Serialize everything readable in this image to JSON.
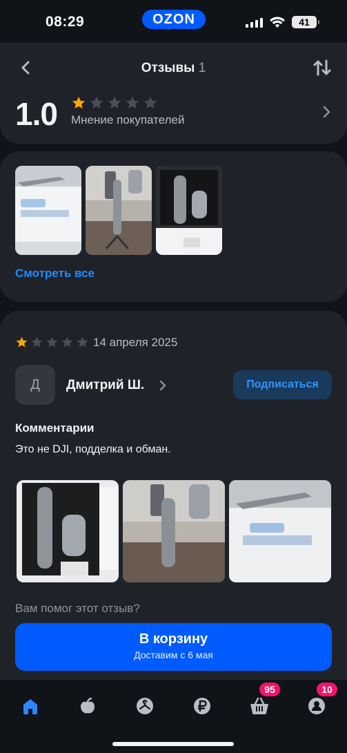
{
  "status_bar": {
    "time": "08:29",
    "brand": "OZON",
    "battery": "41"
  },
  "header": {
    "title": "Отзывы",
    "count": "1",
    "rating": "1.0",
    "rating_stars_filled": 1,
    "rating_stars_total": 5,
    "rating_caption": "Мнение покупателей"
  },
  "photos": {
    "see_all": "Смотреть все",
    "items": [
      "photo-box-3-axis-gimbal",
      "photo-gimbal-on-chair",
      "photo-gimbal-in-box"
    ]
  },
  "review": {
    "stars_filled": 1,
    "stars_total": 5,
    "date": "14 апреля 2025",
    "avatar_letter": "Д",
    "author": "Дмитрий Ш.",
    "subscribe_label": "Подписаться",
    "comment_label": "Комментарии",
    "comment_text": "Это не DJI, подделка и обман.",
    "helpful_question": "Вам помог этот отзыв?"
  },
  "cart_button": {
    "title": "В корзину",
    "subtitle": "Доставим с 6 мая"
  },
  "tab_bar": {
    "items": [
      {
        "icon": "home-icon",
        "active": true
      },
      {
        "icon": "fresh-icon",
        "active": false
      },
      {
        "icon": "catalog-icon",
        "active": false
      },
      {
        "icon": "finance-icon",
        "active": false
      },
      {
        "icon": "cart-icon",
        "active": false,
        "badge": "95"
      },
      {
        "icon": "profile-icon",
        "active": false,
        "badge": "10"
      }
    ]
  },
  "colors": {
    "accent": "#005bff",
    "link": "#1e8cff",
    "star_filled": "#ffa800",
    "star_empty": "#4a4f57",
    "badge": "#f3136c",
    "card": "#1f2329",
    "background": "#101317"
  }
}
